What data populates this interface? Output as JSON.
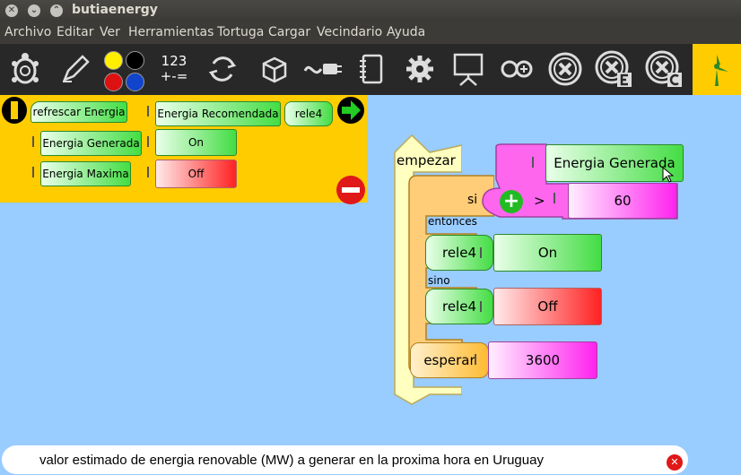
{
  "window": {
    "title": "butiaenergy"
  },
  "menu": [
    "Archivo",
    "Editar",
    "Ver",
    "Herramientas",
    "Tortuga",
    "Cargar",
    "Vecindario",
    "Ayuda"
  ],
  "toolbar": {
    "number_label": "123",
    "ops_label": "+-=",
    "dot_colors": [
      "#ffee00",
      "#000000",
      "#dd1111",
      "#1144cc"
    ]
  },
  "palette": {
    "refresh": "refrescar Energia",
    "recommended": "Energia Recomendada",
    "relay": "rele4",
    "generated": "Energia Generada",
    "maximum": "Energia Maxima",
    "on": "On",
    "off": "Off"
  },
  "program": {
    "start": "empezar",
    "if": "si",
    "then": "entonces",
    "else": "sino",
    "compare_left": "Energia Generada",
    "operator": ">",
    "compare_right": "60",
    "relay1": "rele4",
    "value_on": "On",
    "relay2": "rele4",
    "value_off": "Off",
    "wait": "esperar",
    "wait_value": "3600"
  },
  "status": {
    "message": "valor estimado de energia renovable (MW) a generar en la proxima hora en Uruguay"
  },
  "colors": {
    "toolbar_bg": "#282828",
    "palette_bg": "#ffcc00",
    "canvas_bg": "#99ccff",
    "relay_green": "#44dd44"
  }
}
